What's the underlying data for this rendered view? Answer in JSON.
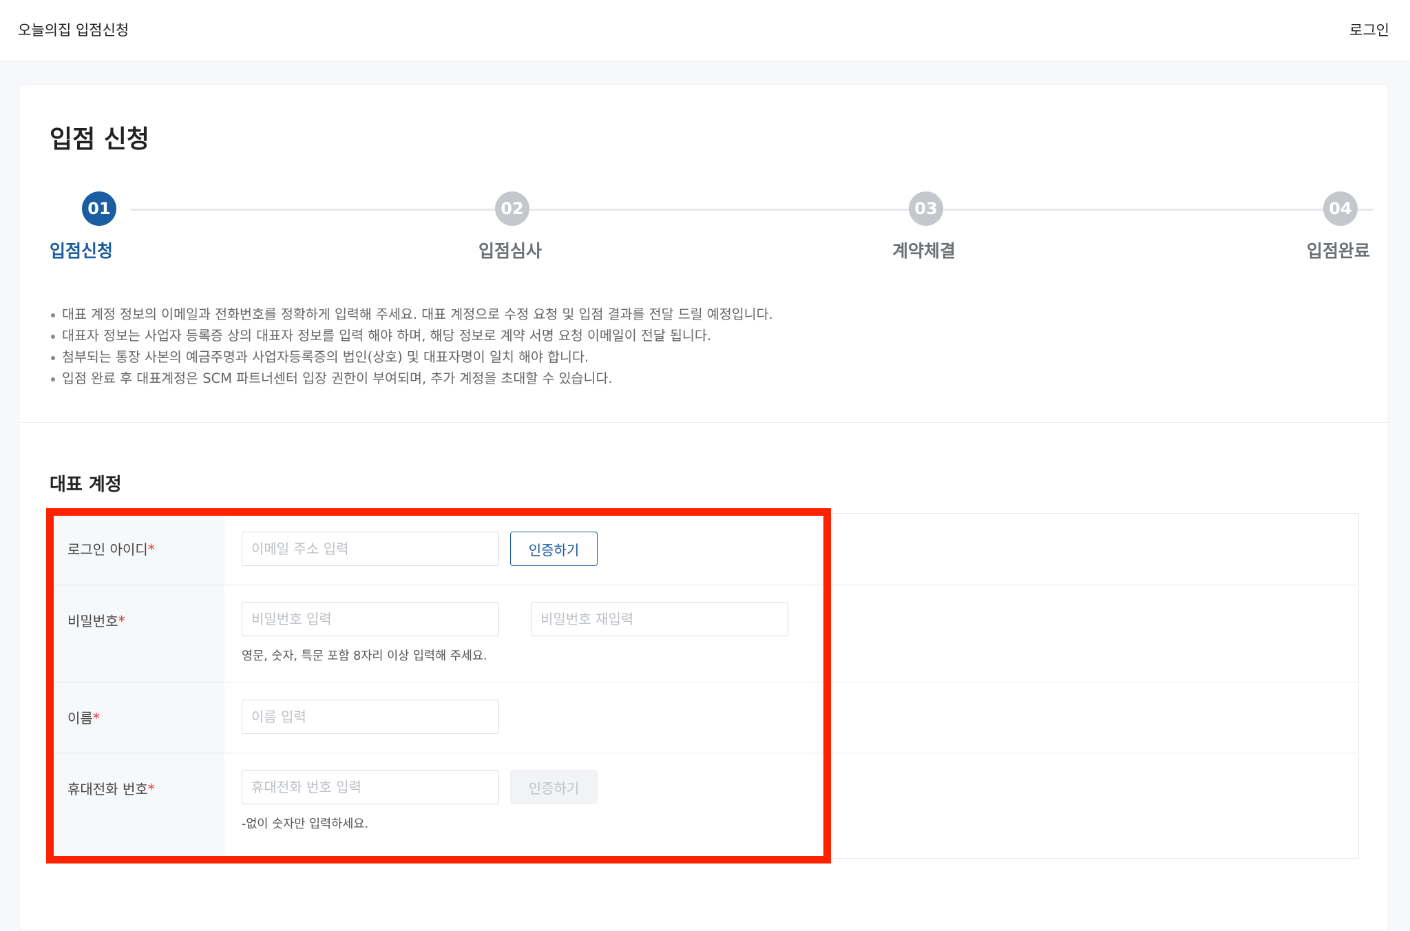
{
  "header": {
    "brand": "오늘의집 입점신청",
    "login": "로그인"
  },
  "page": {
    "title": "입점 신청"
  },
  "steps": [
    {
      "number": "01",
      "label": "입점신청",
      "active": true
    },
    {
      "number": "02",
      "label": "입점심사",
      "active": false
    },
    {
      "number": "03",
      "label": "계약체결",
      "active": false
    },
    {
      "number": "04",
      "label": "입점완료",
      "active": false
    }
  ],
  "notes": [
    "대표 계정 정보의 이메일과 전화번호를 정확하게 입력해 주세요. 대표 계정으로 수정 요청 및 입점 결과를 전달 드릴 예정입니다.",
    "대표자 정보는 사업자 등록증 상의 대표자 정보를 입력 해야 하며, 해당 정보로 계약 서명 요청 이메일이 전달 됩니다.",
    "첨부되는 통장 사본의 예금주명과 사업자등록증의 법인(상호) 및 대표자명이 일치 해야 합니다.",
    "입점 완료 후 대표계정은 SCM 파트너센터 입장 권한이 부여되며, 추가 계정을 초대할 수 있습니다."
  ],
  "section": {
    "title": "대표 계정"
  },
  "form": {
    "login_id": {
      "label": "로그인 아이디",
      "required": "*",
      "placeholder": "이메일 주소 입력",
      "button": "인증하기"
    },
    "password": {
      "label": "비밀번호",
      "required": "*",
      "placeholder": "비밀번호 입력",
      "confirm_placeholder": "비밀번호 재입력",
      "hint": "영문, 숫자, 특문 포함 8자리 이상 입력해 주세요."
    },
    "name": {
      "label": "이름",
      "required": "*",
      "placeholder": "이름 입력"
    },
    "phone": {
      "label": "휴대전화 번호",
      "required": "*",
      "placeholder": "휴대전화 번호 입력",
      "button": "인증하기",
      "hint": "-없이 숫자만 입력하세요."
    }
  },
  "colors": {
    "accent": "#1a5da0",
    "required": "#e8353c",
    "highlight": "#ff2200"
  }
}
